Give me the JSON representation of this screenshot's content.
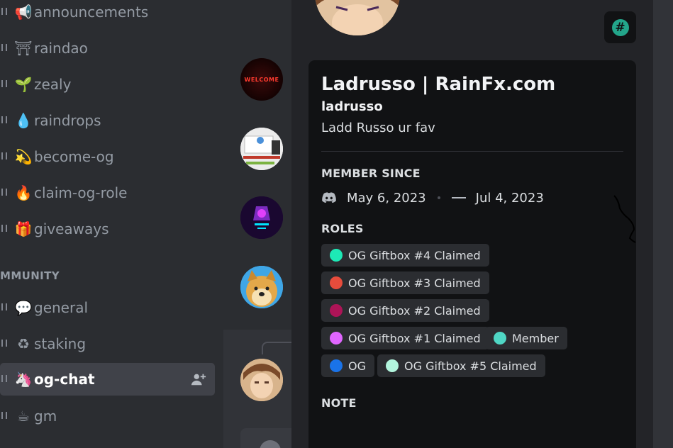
{
  "sidebar": {
    "channels": [
      {
        "emoji": "📢",
        "label": "announcements"
      },
      {
        "emoji": "⛩",
        "label": "raindao"
      },
      {
        "emoji": "🌱",
        "label": "zealy"
      },
      {
        "emoji": "💧",
        "label": "raindrops"
      },
      {
        "emoji": "💫",
        "label": "become-og"
      },
      {
        "emoji": "🔥",
        "label": "claim-og-role"
      },
      {
        "emoji": "🎁",
        "label": "giveaways"
      }
    ],
    "category": "MMUNITY",
    "community_channels": [
      {
        "emoji": "💬",
        "label": "general"
      },
      {
        "emoji": "♻",
        "label": "staking"
      },
      {
        "emoji": "🦄",
        "label": "og-chat"
      },
      {
        "emoji": "☕",
        "label": "gm"
      }
    ]
  },
  "members": {
    "welcome_avatar_text": "WELCOME"
  },
  "profile": {
    "display_name": "Ladrusso | RainFx.com",
    "username": "ladrusso",
    "bio": "Ladd Russo ur fav",
    "member_since_title": "MEMBER SINCE",
    "discord_join_date": "May 6, 2023",
    "server_join_date": "Jul 4, 2023",
    "roles_title": "ROLES",
    "roles": [
      {
        "label": "OG Giftbox #4 Claimed",
        "color": "#1de9b6"
      },
      {
        "label": "OG Giftbox #3 Claimed",
        "color": "#e74c3c"
      },
      {
        "label": "OG Giftbox #2 Claimed",
        "color": "#ad1457"
      },
      {
        "label": "OG Giftbox #1 Claimed",
        "color": "#e066ff"
      },
      {
        "label": "Member",
        "color": "#4fd6c4"
      },
      {
        "label": "OG",
        "color": "#1a73e8"
      },
      {
        "label": "OG Giftbox #5 Claimed",
        "color": "#b2f5dd"
      }
    ],
    "note_title": "NOTE",
    "hash_badge": "#"
  },
  "colors": {
    "sidebar_bg": "#2b2d31",
    "panel_bg": "#232428",
    "card_bg": "#111214",
    "active_channel": "#404249",
    "badge_green": "#23a58a"
  }
}
